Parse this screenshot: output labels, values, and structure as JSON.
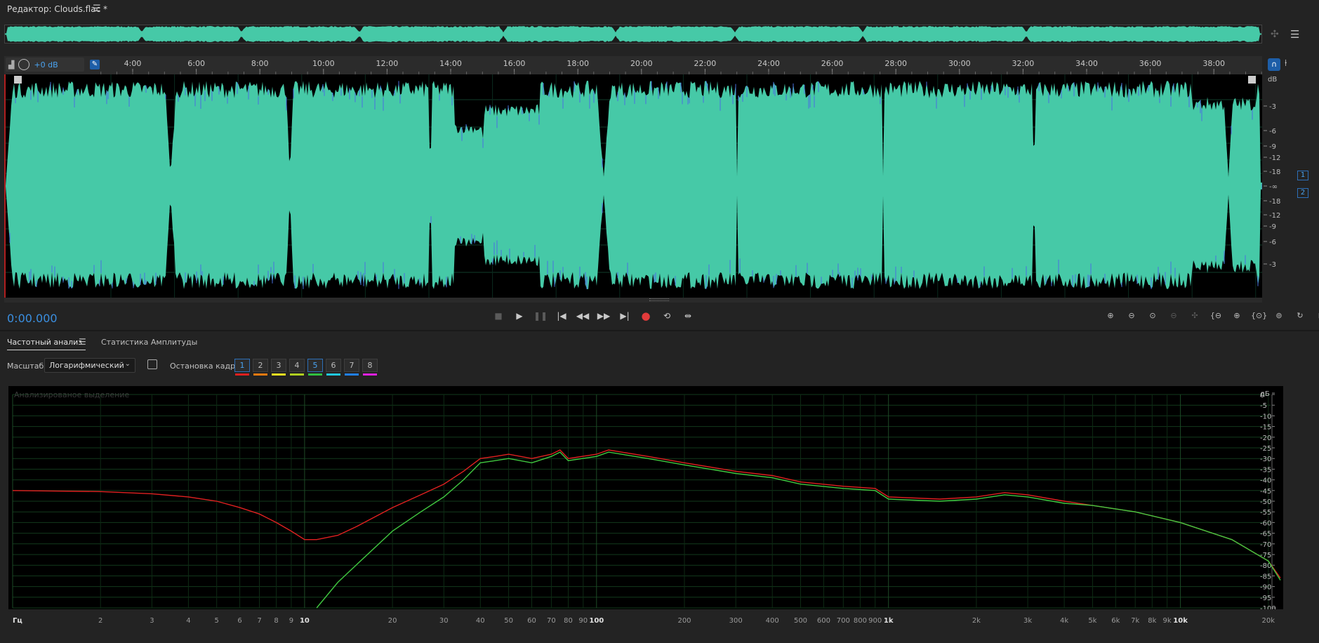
{
  "window": {
    "title": "Редактор: Clouds.flac *",
    "menu_icon": "hamburger-icon"
  },
  "overview": {
    "icons": [
      "zoom-out-full-icon",
      "panel-layout-icon"
    ]
  },
  "ruler": {
    "ticks": [
      "4:00",
      "6:00",
      "8:00",
      "10:00",
      "12:00",
      "14:00",
      "16:00",
      "18:00",
      "20:00",
      "22:00",
      "24:00",
      "26:00",
      "28:00",
      "30:00",
      "32:00",
      "34:00",
      "36:00",
      "38:00"
    ]
  },
  "hud": {
    "volume": "+0 dB",
    "icons": [
      "meter-icon",
      "volume-knob-icon",
      "pin-icon"
    ]
  },
  "editor_right_icons": [
    "headphones-icon",
    "marker-icon"
  ],
  "amplitude_scale": {
    "unit": "dB",
    "labels": [
      "-3",
      "-6",
      "-9",
      "-12",
      "-18",
      "-∞",
      "-18",
      "-12",
      "-9",
      "-6",
      "-3"
    ]
  },
  "channels": [
    "1",
    "2"
  ],
  "transport": {
    "time": "0:00.000",
    "buttons": [
      "stop-icon",
      "play-icon",
      "pause-icon",
      "go-to-start-icon",
      "rewind-icon",
      "fast-forward-icon",
      "go-to-end-icon",
      "record-icon",
      "loop-icon",
      "skip-selection-icon"
    ]
  },
  "zoom_buttons": [
    "zoom-in-amplitude-icon",
    "zoom-out-amplitude-icon",
    "zoom-reset-amplitude-icon",
    "zoom-selection-icon",
    "zoom-in-time-icon",
    "zoom-out-time-icon",
    "zoom-in-time-2-icon",
    "zoom-out-full-icon",
    "zoom-selection-2-icon",
    "zoom-in-start-icon",
    "zoom-in-end-icon"
  ],
  "panel": {
    "tabs": [
      "Частотный анализ",
      "Статистика Амплитуды"
    ],
    "scale_label": "Масштаб:",
    "scale_value": "Логарифмический",
    "frame_label": "Остановка кадра:",
    "frames": [
      {
        "label": "1",
        "color": "#e02020",
        "active": true
      },
      {
        "label": "2",
        "color": "#f07a10",
        "active": false
      },
      {
        "label": "3",
        "color": "#f0e020",
        "active": false
      },
      {
        "label": "4",
        "color": "#b0d020",
        "active": false
      },
      {
        "label": "5",
        "color": "#30c040",
        "active": true
      },
      {
        "label": "6",
        "color": "#20c8e0",
        "active": false
      },
      {
        "label": "7",
        "color": "#2080f0",
        "active": false
      },
      {
        "label": "8",
        "color": "#e020e0",
        "active": false
      }
    ],
    "caption": "Анализированое выделение"
  },
  "colors": {
    "waveform": "#46c9a7",
    "accent": "#3b8fe0",
    "spectrum_left": "#e02020",
    "spectrum_right": "#40c840"
  },
  "chart_data": {
    "type": "line",
    "xscale": "log",
    "xlim": [
      1,
      22000
    ],
    "ylim": [
      -100,
      0
    ],
    "ylabel": "дБ",
    "y_ticks": [
      "дБ",
      "0",
      "-5",
      "-10",
      "-15",
      "-20",
      "-25",
      "-30",
      "-35",
      "-40",
      "-45",
      "-50",
      "-55",
      "-60",
      "-65",
      "-70",
      "-75",
      "-80",
      "-85",
      "-90",
      "-95",
      "-100"
    ],
    "x_ticks": [
      {
        "v": 1,
        "l": "Гц"
      },
      {
        "v": 2,
        "l": "2"
      },
      {
        "v": 3,
        "l": "3"
      },
      {
        "v": 4,
        "l": "4"
      },
      {
        "v": 5,
        "l": "5"
      },
      {
        "v": 6,
        "l": "6"
      },
      {
        "v": 7,
        "l": "7"
      },
      {
        "v": 8,
        "l": "8"
      },
      {
        "v": 9,
        "l": "9"
      },
      {
        "v": 10,
        "l": "10"
      },
      {
        "v": 20,
        "l": "20"
      },
      {
        "v": 30,
        "l": "30"
      },
      {
        "v": 40,
        "l": "40"
      },
      {
        "v": 50,
        "l": "50"
      },
      {
        "v": 60,
        "l": "60"
      },
      {
        "v": 70,
        "l": "70"
      },
      {
        "v": 80,
        "l": "80"
      },
      {
        "v": 90,
        "l": "90"
      },
      {
        "v": 100,
        "l": "100"
      },
      {
        "v": 200,
        "l": "200"
      },
      {
        "v": 300,
        "l": "300"
      },
      {
        "v": 400,
        "l": "400"
      },
      {
        "v": 500,
        "l": "500"
      },
      {
        "v": 600,
        "l": "600"
      },
      {
        "v": 700,
        "l": "700"
      },
      {
        "v": 800,
        "l": "800"
      },
      {
        "v": 900,
        "l": "900"
      },
      {
        "v": 1000,
        "l": "1k"
      },
      {
        "v": 2000,
        "l": "2k"
      },
      {
        "v": 3000,
        "l": "3k"
      },
      {
        "v": 4000,
        "l": "4k"
      },
      {
        "v": 5000,
        "l": "5k"
      },
      {
        "v": 6000,
        "l": "6k"
      },
      {
        "v": 7000,
        "l": "7k"
      },
      {
        "v": 8000,
        "l": "8k"
      },
      {
        "v": 9000,
        "l": "9k"
      },
      {
        "v": 10000,
        "l": "10k"
      },
      {
        "v": 20000,
        "l": "20k"
      }
    ],
    "series": [
      {
        "points": [
          [
            1,
            -45
          ],
          [
            2,
            -45.5
          ],
          [
            3,
            -46.5
          ],
          [
            4,
            -48
          ],
          [
            5,
            -50
          ],
          [
            6,
            -53
          ],
          [
            7,
            -56
          ],
          [
            8,
            -60
          ],
          [
            9,
            -64
          ],
          [
            10,
            -68
          ],
          [
            11,
            -68
          ],
          [
            13,
            -66
          ],
          [
            15,
            -62
          ],
          [
            20,
            -53
          ],
          [
            25,
            -47
          ],
          [
            30,
            -42
          ],
          [
            35,
            -36
          ],
          [
            40,
            -30
          ],
          [
            45,
            -29
          ],
          [
            50,
            -28
          ],
          [
            60,
            -30
          ],
          [
            70,
            -28
          ],
          [
            75,
            -26
          ],
          [
            80,
            -30
          ],
          [
            100,
            -28
          ],
          [
            110,
            -26
          ],
          [
            150,
            -29
          ],
          [
            200,
            -32
          ],
          [
            300,
            -36
          ],
          [
            400,
            -38
          ],
          [
            500,
            -41
          ],
          [
            700,
            -43
          ],
          [
            900,
            -44
          ],
          [
            1000,
            -48
          ],
          [
            1500,
            -49
          ],
          [
            2000,
            -48
          ],
          [
            2500,
            -46
          ],
          [
            3000,
            -47
          ],
          [
            4000,
            -50
          ],
          [
            5000,
            -52
          ],
          [
            7000,
            -55
          ],
          [
            10000,
            -60
          ],
          [
            15000,
            -68
          ],
          [
            20000,
            -78
          ],
          [
            22000,
            -86
          ]
        ]
      },
      {
        "points": [
          [
            11,
            -100
          ],
          [
            13,
            -88
          ],
          [
            15,
            -80
          ],
          [
            20,
            -64
          ],
          [
            25,
            -55
          ],
          [
            30,
            -48
          ],
          [
            35,
            -40
          ],
          [
            40,
            -32
          ],
          [
            45,
            -31
          ],
          [
            50,
            -30
          ],
          [
            60,
            -32
          ],
          [
            70,
            -29
          ],
          [
            75,
            -27
          ],
          [
            80,
            -31
          ],
          [
            100,
            -29
          ],
          [
            110,
            -27
          ],
          [
            150,
            -30
          ],
          [
            200,
            -33
          ],
          [
            300,
            -37
          ],
          [
            400,
            -39
          ],
          [
            500,
            -42
          ],
          [
            700,
            -44
          ],
          [
            900,
            -45
          ],
          [
            1000,
            -49
          ],
          [
            1500,
            -50
          ],
          [
            2000,
            -49
          ],
          [
            2500,
            -47
          ],
          [
            3000,
            -48
          ],
          [
            4000,
            -51
          ],
          [
            5000,
            -52
          ],
          [
            7000,
            -55
          ],
          [
            10000,
            -60
          ],
          [
            15000,
            -68
          ],
          [
            20000,
            -78
          ],
          [
            22000,
            -87
          ]
        ]
      }
    ]
  }
}
